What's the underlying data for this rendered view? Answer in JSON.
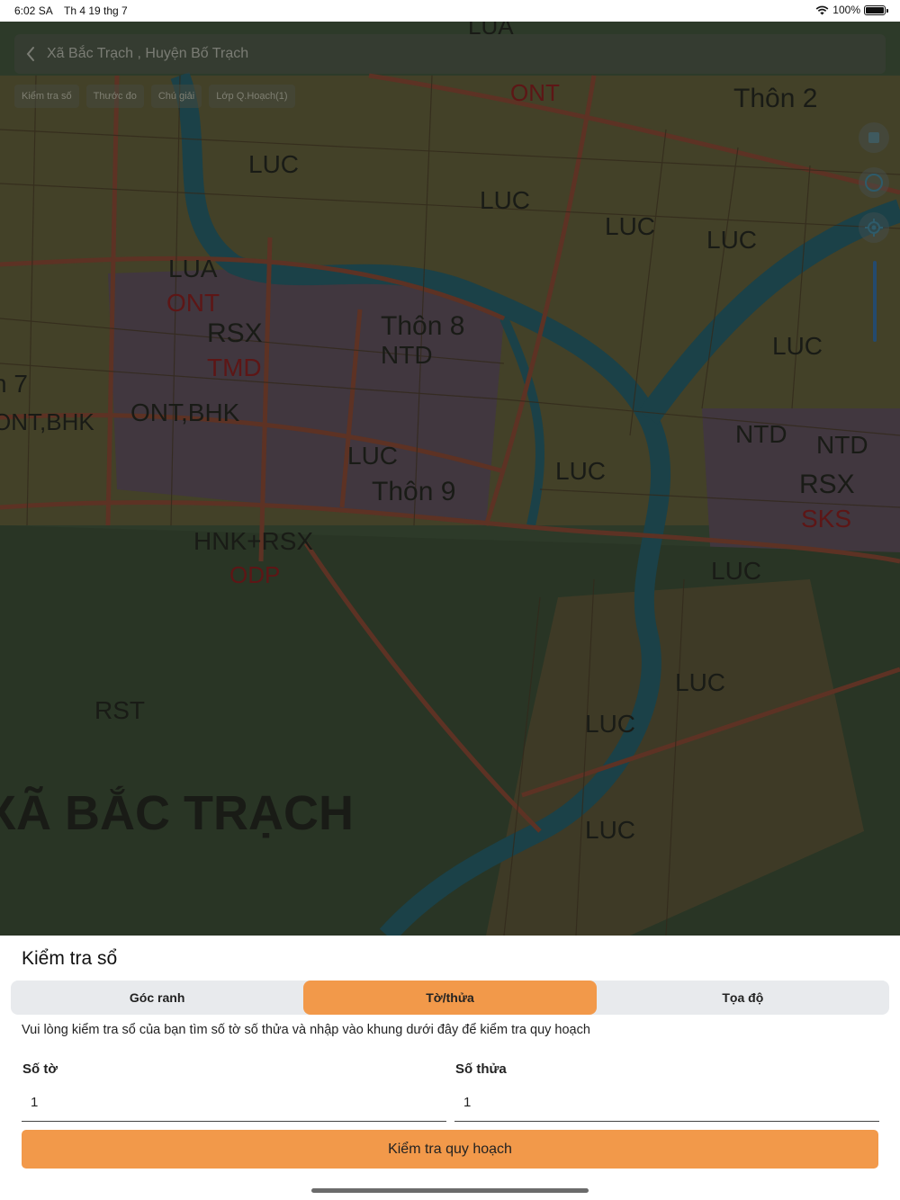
{
  "status_bar": {
    "time": "6:02 SA",
    "date": "Th 4 19 thg 7",
    "battery": "100%"
  },
  "header": {
    "title": "Xã Bắc Trạch , Huyện Bố Trạch"
  },
  "chips": [
    "Kiểm tra số",
    "Thước đo",
    "Chú giải",
    "Lớp Q.Hoạch(1)"
  ],
  "map_labels": {
    "luc": "LUC",
    "lua": "LUA",
    "ont": "ONT",
    "rsx": "RSX",
    "tmd": "TMD",
    "thon2": "Thôn 2",
    "thon8": "Thôn 8",
    "thon9": "Thôn 9",
    "ntd": "NTD",
    "ont_bhk": "ONT,BHK",
    "n7": "n 7",
    "hnk_rsx": "HNK+RSX",
    "odp": "ODP",
    "sks": "SKS",
    "rst": "RST",
    "commune": "XÃ BẮC TRẠCH",
    "top_fragment": "LUA"
  },
  "sheet": {
    "heading": "Kiểm tra sổ",
    "tabs": [
      "Góc ranh",
      "Tờ/thửa",
      "Tọa độ"
    ],
    "active_tab": "Tờ/thửa",
    "hint": "Vui lòng kiểm tra sổ của bạn tìm số tờ số thửa và nhập vào khung dưới đây để kiểm tra quy hoạch",
    "so_to_label": "Số tờ",
    "so_to_value": "1",
    "so_thua_label": "Số thửa",
    "so_thua_value": "1",
    "submit_label": "Kiểm tra quy hoạch"
  },
  "colors": {
    "accent": "#f2994a",
    "map_dim": "#2a3a2c"
  }
}
